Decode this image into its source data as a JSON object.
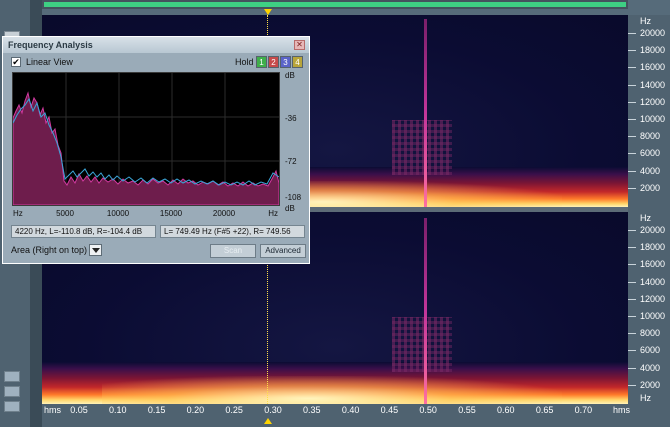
{
  "freq_window": {
    "title": "Frequency Analysis",
    "close_glyph": "✕",
    "linear_view_checked_glyph": "✔",
    "linear_view_label": "Linear View",
    "hold_label": "Hold",
    "hold_buttons": [
      {
        "label": "1",
        "color": "#3fae4a"
      },
      {
        "label": "2",
        "color": "#c64a4a"
      },
      {
        "label": "3",
        "color": "#5a63c8"
      },
      {
        "label": "4",
        "color": "#b8a53a"
      }
    ],
    "db_labels": [
      "dB",
      "-36",
      "-72",
      "-108",
      "dB"
    ],
    "x_labels": [
      "Hz",
      "5000",
      "10000",
      "15000",
      "20000",
      "Hz"
    ],
    "status_left": "4220 Hz, L=-110.8 dB, R=-104.4 dB",
    "status_right": "L= 749.49 Hz (F#5 +22), R= 749.56",
    "display_mode": "Area (Right on top)",
    "scan_label": "Scan",
    "advanced_label": "Advanced"
  },
  "hz_scale": {
    "unit": "Hz",
    "labels": [
      "20000",
      "18000",
      "16000",
      "14000",
      "12000",
      "10000",
      "8000",
      "6000",
      "4000",
      "2000"
    ]
  },
  "time_ruler": {
    "start_label": "hms",
    "labels": [
      "0.05",
      "0.10",
      "0.15",
      "0.20",
      "0.25",
      "0.30",
      "0.35",
      "0.40",
      "0.45",
      "0.50",
      "0.55",
      "0.60",
      "0.65",
      "0.70"
    ],
    "end_label": "hms"
  },
  "colors": {
    "spectrogram_bg": "#0b0d3a",
    "left_series": "#c2359a",
    "right_series": "#3aa6d8",
    "cursor": "#ffe04a",
    "activity_bar": "#3ed083"
  }
}
